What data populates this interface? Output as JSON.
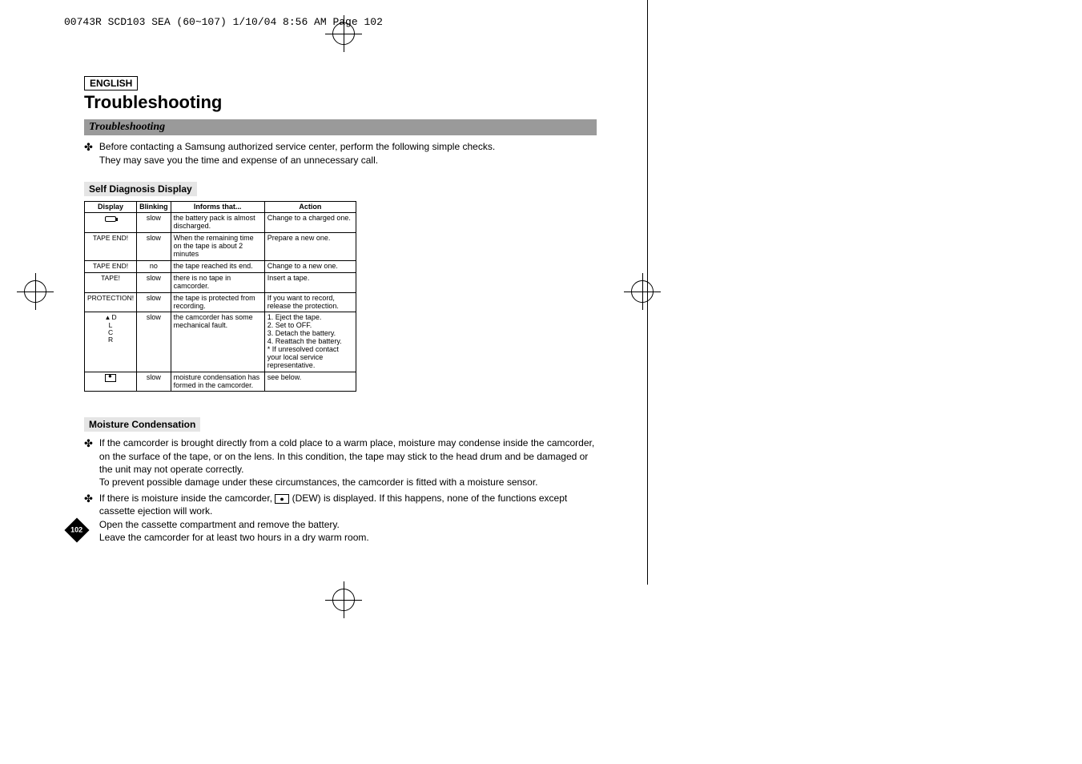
{
  "header_line": "00743R SCD103 SEA (60~107)  1/10/04 8:56 AM  Page 102",
  "lang_label": "ENGLISH",
  "title": "Troubleshooting",
  "section_bar": "Troubleshooting",
  "intro_line1": "Before contacting a Samsung authorized service center, perform the following simple checks.",
  "intro_line2": "They may save you the time and expense of an unnecessary call.",
  "subhead1": "Self Diagnosis Display",
  "table": {
    "headers": [
      "Display",
      "Blinking",
      "Informs that...",
      "Action"
    ],
    "rows": [
      {
        "display_icon": "battery",
        "display": "",
        "blinking": "slow",
        "informs": "the battery pack is almost discharged.",
        "action": "Change to a charged one."
      },
      {
        "display": "TAPE END!",
        "blinking": "slow",
        "informs": "When the remaining time on the tape is about 2 minutes",
        "action": "Prepare a new one."
      },
      {
        "display": "TAPE END!",
        "blinking": "no",
        "informs": "the tape reached its end.",
        "action": "Change to a new one."
      },
      {
        "display": "TAPE!",
        "blinking": "slow",
        "informs": "there is no tape in camcorder.",
        "action": "Insert a tape."
      },
      {
        "display": "PROTECTION!",
        "blinking": "slow",
        "informs": "the tape is protected from recording.",
        "action": "If you want to record, release the protection."
      },
      {
        "display_icon": "eject",
        "display": "D\nL\nC\nR",
        "blinking": "slow",
        "informs": "the camcorder has some mechanical fault.",
        "action": "1. Eject the tape.\n2. Set to OFF.\n3. Detach the battery.\n4. Reattach the battery.\n* If unresolved contact your local service representative."
      },
      {
        "display_icon": "dew",
        "display": "",
        "blinking": "slow",
        "informs": "moisture condensation has formed in the camcorder.",
        "action": "see below."
      }
    ]
  },
  "subhead2": "Moisture Condensation",
  "moisture": {
    "p1": "If the camcorder is brought directly from a cold place to a warm place, moisture may condense inside the camcorder, on the surface of the tape, or on the lens. In this condition, the tape may stick to the head drum and be damaged or the unit may not operate correctly.",
    "p1b": "To prevent possible damage under these circumstances, the camcorder is fitted with a moisture sensor.",
    "p2a": "If there is moisture inside the camcorder, ",
    "p2b": " (DEW) is displayed. If this happens, none of the functions except cassette ejection will work.",
    "p3": "Open the cassette compartment and remove the battery.",
    "p4": "Leave the camcorder for at least two hours in a dry warm room."
  },
  "page_number": "102"
}
